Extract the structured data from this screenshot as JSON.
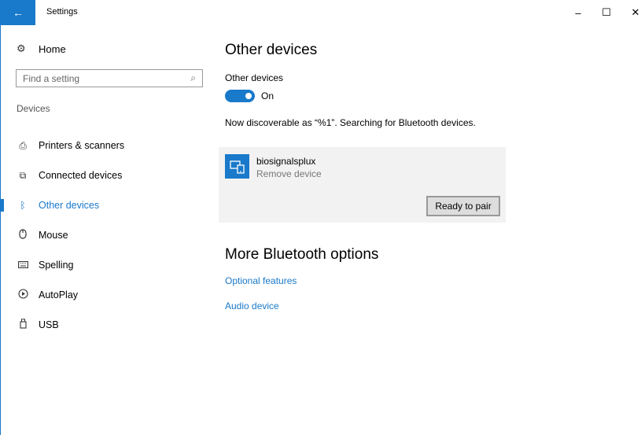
{
  "window": {
    "title": "Settings",
    "back_icon": "back-arrow-icon",
    "minimize": "–",
    "maximize": "☐",
    "close": "✕"
  },
  "sidebar": {
    "home_label": "Home",
    "search_placeholder": "Find a setting",
    "section_label": "Devices",
    "items": [
      {
        "label": "Printers & scanners",
        "icon": "printer-icon",
        "glyph": "⎙"
      },
      {
        "label": "Connected devices",
        "icon": "connected-devices-icon",
        "glyph": "⧉"
      },
      {
        "label": "Other devices",
        "icon": "bluetooth-icon",
        "glyph": "ᛒ"
      },
      {
        "label": "Mouse",
        "icon": "mouse-icon",
        "glyph": "🖱"
      },
      {
        "label": "Spelling",
        "icon": "keyboard-icon",
        "glyph": "⌨"
      },
      {
        "label": "AutoPlay",
        "icon": "autoplay-icon",
        "glyph": "⟳"
      },
      {
        "label": "USB",
        "icon": "usb-icon",
        "glyph": "▯"
      }
    ]
  },
  "main": {
    "title": "Other devices",
    "toggle_label": "Other devices",
    "toggle_state": "On",
    "status": "Now discoverable as “%1”. Searching for Bluetooth devices.",
    "device": {
      "name": "biosignalsplux",
      "action": "Remove device",
      "button": "Ready to pair",
      "icon": "device-icon"
    },
    "more_title": "More Bluetooth options",
    "links": [
      "Optional features",
      "Audio device"
    ]
  },
  "colors": {
    "accent": "#1979ca"
  }
}
